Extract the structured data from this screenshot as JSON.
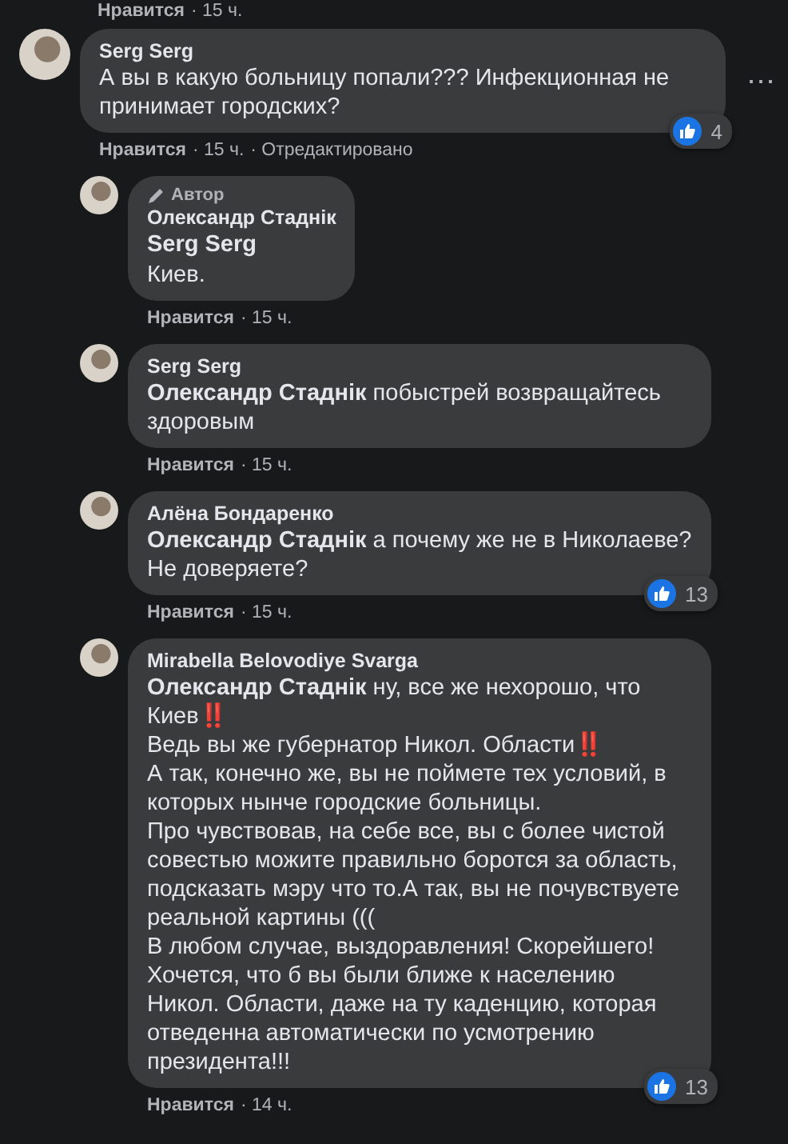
{
  "previous_meta": {
    "like": "Нравится",
    "time": "· 15 ч."
  },
  "comments": [
    {
      "author": "Serg Serg",
      "text": "А вы в какую больницу попали??? Инфекционная не принимает городских?",
      "reactions": "4",
      "like": "Нравится",
      "time": "· 15 ч.",
      "edited": "· Отредактировано",
      "menu": "⋯",
      "children": [
        {
          "author": "Олександр Стаднік",
          "author_badge": "Автор",
          "mention": "Serg Serg",
          "mention_on_own_line": true,
          "text": "Киев.",
          "like": "Нравится",
          "time": "· 15 ч."
        },
        {
          "author": "Serg Serg",
          "mention": "Олександр Стаднік",
          "mention_on_own_line": false,
          "text": "побыстрей возвращайтесь здоровым",
          "like": "Нравится",
          "time": "· 15 ч."
        },
        {
          "author": "Алёна Бондаренко",
          "mention": "Олександр Стаднік",
          "mention_on_own_line": false,
          "text": "а почему же не в Николаеве? Не доверяете?",
          "reactions": "13",
          "like": "Нравится",
          "time": "· 15 ч."
        },
        {
          "author": "Mirabella Belovodiye Svarga",
          "mention": "Олександр Стаднік",
          "mention_on_own_line": false,
          "text": "ну, все же нехорошо, что Киев‼️\nВедь вы же губернатор Никол. Области‼️\nА так, конечно же, вы не поймете тех условий, в которых нынче городские больницы.\nПро чувствовав, на себе все, вы с более чистой совестью можите правильно боротся за область, подсказать мэру что то.А так, вы не почувствуете реальной картины (((\nВ любом случае, выздоравления! Скорейшего!\nХочется, что б вы были ближе к населению Никол. Области, даже на ту каденцию, которая отведенна автоматически по усмотрению президента!!!",
          "reactions": "13",
          "like": "Нравится",
          "time": "· 14 ч."
        }
      ]
    }
  ]
}
